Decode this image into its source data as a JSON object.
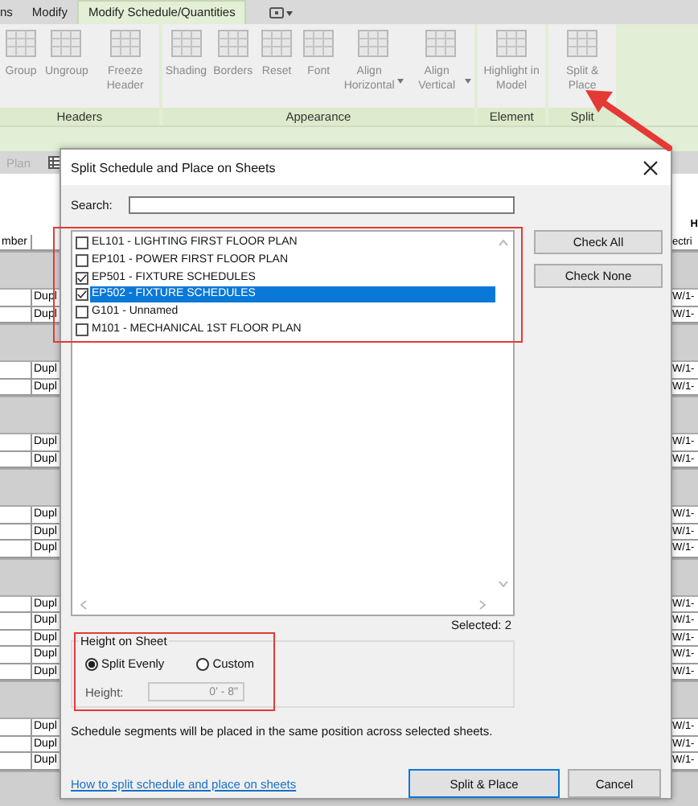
{
  "ribbon": {
    "tabs": [
      {
        "label": "ns",
        "selected": false
      },
      {
        "label": "Modify",
        "selected": false
      },
      {
        "label": "Modify Schedule/Quantities",
        "selected": true
      }
    ],
    "groups": [
      {
        "label": "Headers",
        "buttons": [
          {
            "label": "Group",
            "dropdown": false
          },
          {
            "label": "Ungroup",
            "dropdown": false
          },
          {
            "label": "Freeze Header",
            "dropdown": false
          }
        ]
      },
      {
        "label": "Appearance",
        "buttons": [
          {
            "label": "Shading",
            "dropdown": false
          },
          {
            "label": "Borders",
            "dropdown": false
          },
          {
            "label": "Reset",
            "dropdown": false
          },
          {
            "label": "Font",
            "dropdown": false
          },
          {
            "label": "Align Horizontal",
            "dropdown": true
          },
          {
            "label": "Align Vertical",
            "dropdown": true
          }
        ]
      },
      {
        "label": "Element",
        "buttons": [
          {
            "label": "Highlight in Model",
            "dropdown": false
          }
        ]
      },
      {
        "label": "Split",
        "buttons": [
          {
            "label": "Split & Place",
            "dropdown": false
          }
        ]
      }
    ]
  },
  "view_tabs": [
    {
      "label": "Plan"
    }
  ],
  "schedule": {
    "rows": [
      {
        "kind": "top",
        "column_4": "H"
      },
      {
        "kind": "header",
        "column_1": "mber",
        "column_4": "ectri"
      },
      {
        "kind": "band"
      },
      {
        "kind": "data",
        "column_2": "Dupl",
        "column_4": "W/1-"
      },
      {
        "kind": "data",
        "column_2": "Dupl",
        "column_4": "W/1-"
      },
      {
        "kind": "band"
      },
      {
        "kind": "data",
        "column_2": "Dupl",
        "column_4": "W/1-"
      },
      {
        "kind": "data",
        "column_2": "Dupl",
        "column_4": "W/1-"
      },
      {
        "kind": "band"
      },
      {
        "kind": "data",
        "column_2": "Dupl",
        "column_4": "W/1-"
      },
      {
        "kind": "data",
        "column_2": "Dupl",
        "column_4": "W/1-"
      },
      {
        "kind": "band"
      },
      {
        "kind": "data",
        "column_2": "Dupl",
        "column_4": "W/1-"
      },
      {
        "kind": "data",
        "column_2": "Dupl",
        "column_4": "W/1-"
      },
      {
        "kind": "data",
        "column_2": "Dupl",
        "column_4": "W/1-"
      },
      {
        "kind": "band"
      },
      {
        "kind": "data",
        "column_2": "Dupl",
        "column_4": "W/1-"
      },
      {
        "kind": "data",
        "column_2": "Dupl",
        "column_4": "W/1-"
      },
      {
        "kind": "data",
        "column_2": "Dupl",
        "column_4": "W/1-"
      },
      {
        "kind": "data",
        "column_2": "Dupl",
        "column_4": "W/1-"
      },
      {
        "kind": "data",
        "column_2": "Dupl",
        "column_4": "W/1-"
      },
      {
        "kind": "band"
      },
      {
        "kind": "data",
        "column_2": "Dupl",
        "column_4": "W/1-"
      },
      {
        "kind": "data",
        "column_2": "Dupl",
        "column_4": "W/1-"
      },
      {
        "kind": "data",
        "column_2": "Dupl",
        "column_4": "W/1-"
      },
      {
        "kind": "band"
      }
    ]
  },
  "dialog": {
    "title": "Split Schedule and Place on Sheets",
    "search": {
      "label": "Search:"
    },
    "side_buttons": [
      "Check All",
      "Check None"
    ],
    "sheets": [
      {
        "label": "EL101 - LIGHTING FIRST FLOOR PLAN",
        "checked": false,
        "selected": false
      },
      {
        "label": "EP101 - POWER FIRST FLOOR PLAN",
        "checked": false,
        "selected": false
      },
      {
        "label": "EP501 - FIXTURE SCHEDULES",
        "checked": true,
        "selected": false
      },
      {
        "label": "EP502 - FIXTURE SCHEDULES",
        "checked": true,
        "selected": true
      },
      {
        "label": "G101 - Unnamed",
        "checked": false,
        "selected": false
      },
      {
        "label": "M101 - MECHANICAL 1ST FLOOR PLAN",
        "checked": false,
        "selected": false
      }
    ],
    "selected_count": "Selected: 2",
    "height_group": {
      "title": "Height on Sheet",
      "options": [
        {
          "label": "Split Evenly",
          "selected": true
        },
        {
          "label": "Custom",
          "selected": false
        }
      ],
      "height": {
        "label": "Height:",
        "value": "0' - 8\"",
        "disabled": true
      }
    },
    "note": "Schedule segments will be placed in the same position across selected sheets.",
    "help_link": "How to split schedule and place on sheets",
    "actions": [
      {
        "label": "Split & Place",
        "default": true
      },
      {
        "label": "Cancel",
        "default": false
      }
    ]
  }
}
